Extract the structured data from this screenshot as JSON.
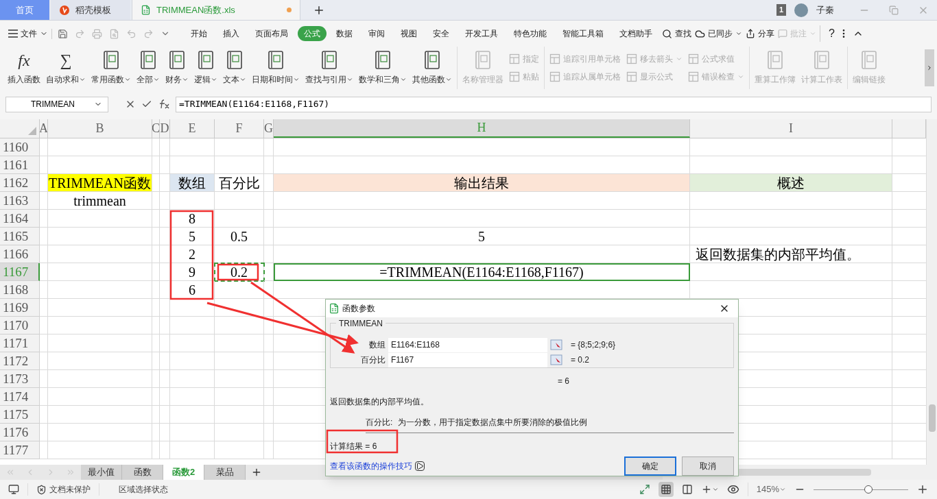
{
  "title_tabs": [
    {
      "label": "首页",
      "selected": false,
      "kind": "home"
    },
    {
      "label": "稻壳模板",
      "selected": false,
      "kind": "template"
    },
    {
      "label": "TRIMMEAN函数.xls",
      "selected": true,
      "kind": "sheet",
      "unsaved": true
    }
  ],
  "account": {
    "badge": "1",
    "name": "子秦"
  },
  "menu": {
    "file": "文件",
    "tabs": [
      {
        "label": "开始",
        "selected": false
      },
      {
        "label": "插入",
        "selected": false
      },
      {
        "label": "页面布局",
        "selected": false
      },
      {
        "label": "公式",
        "selected": true
      },
      {
        "label": "数据",
        "selected": false
      },
      {
        "label": "审阅",
        "selected": false
      },
      {
        "label": "视图",
        "selected": false
      },
      {
        "label": "安全",
        "selected": false
      },
      {
        "label": "开发工具",
        "selected": false
      },
      {
        "label": "特色功能",
        "selected": false
      },
      {
        "label": "智能工具箱",
        "selected": false
      },
      {
        "label": "文档助手",
        "selected": false
      }
    ],
    "search": "查找",
    "sync": "已同步",
    "share": "分享",
    "comment": "批注",
    "comment_disabled": true,
    "help": "?"
  },
  "ribbon": [
    [
      {
        "kind": "large",
        "label": "插入函数",
        "glyph": "fx",
        "disabled": false,
        "dropdown": false
      },
      {
        "kind": "large",
        "label": "自动求和",
        "glyph": "∑",
        "disabled": false,
        "dropdown": true
      },
      {
        "kind": "large",
        "label": "常用函数",
        "disabled": false,
        "dropdown": true
      },
      {
        "kind": "large",
        "label": "全部",
        "disabled": false,
        "dropdown": true
      },
      {
        "kind": "large",
        "label": "财务",
        "disabled": false,
        "dropdown": true
      },
      {
        "kind": "large",
        "label": "逻辑",
        "disabled": false,
        "dropdown": true
      },
      {
        "kind": "large",
        "label": "文本",
        "disabled": false,
        "dropdown": true
      },
      {
        "kind": "large",
        "label": "日期和时间",
        "disabled": false,
        "dropdown": true
      },
      {
        "kind": "large",
        "label": "查找与引用",
        "disabled": false,
        "dropdown": true
      },
      {
        "kind": "large",
        "label": "数学和三角",
        "disabled": false,
        "dropdown": true
      },
      {
        "kind": "large",
        "label": "其他函数",
        "disabled": false,
        "dropdown": true
      }
    ],
    [
      {
        "kind": "large",
        "label": "名称管理器",
        "disabled": true,
        "dropdown": false
      },
      {
        "kind": "stack",
        "items": [
          {
            "label": "指定",
            "disabled": true,
            "dropdown": false
          },
          {
            "label": "粘贴",
            "disabled": true,
            "dropdown": false
          }
        ]
      }
    ],
    [
      {
        "kind": "stack",
        "items": [
          {
            "label": "追踪引用单元格",
            "disabled": true,
            "dropdown": false
          },
          {
            "label": "追踪从属单元格",
            "disabled": true,
            "dropdown": false
          }
        ]
      },
      {
        "kind": "stack",
        "items": [
          {
            "label": "移去箭头",
            "disabled": true,
            "dropdown": true
          },
          {
            "label": "显示公式",
            "disabled": true,
            "dropdown": false
          }
        ]
      },
      {
        "kind": "stack",
        "items": [
          {
            "label": "公式求值",
            "disabled": true,
            "dropdown": false
          },
          {
            "label": "错误检查",
            "disabled": true,
            "dropdown": true
          }
        ]
      }
    ],
    [
      {
        "kind": "large",
        "label": "重算工作簿",
        "disabled": true,
        "dropdown": false
      },
      {
        "kind": "large",
        "label": "计算工作表",
        "disabled": true,
        "dropdown": false
      }
    ],
    [
      {
        "kind": "large",
        "label": "编辑链接",
        "disabled": true,
        "dropdown": false
      }
    ]
  ],
  "formula_bar": {
    "name_box": "TRIMMEAN",
    "formula": "=TRIMMEAN(E1164:E1168,F1167)"
  },
  "sheet": {
    "columns": [
      {
        "label": "A",
        "selected": false
      },
      {
        "label": "B",
        "selected": false
      },
      {
        "label": "C",
        "selected": false
      },
      {
        "label": "D",
        "selected": false
      },
      {
        "label": "E",
        "selected": false
      },
      {
        "label": "F",
        "selected": false
      },
      {
        "label": "G",
        "selected": false
      },
      {
        "label": "H",
        "selected": true
      },
      {
        "label": "I",
        "selected": false
      }
    ],
    "rows": [
      {
        "number": "1160",
        "selected": false
      },
      {
        "number": "1161",
        "selected": false
      },
      {
        "number": "1162",
        "selected": false,
        "cells": [
          {},
          {
            "text": "TRIMMEAN函数",
            "color": "#ffff00"
          },
          {},
          {},
          {
            "text": "数组",
            "color": "#dce6f1"
          },
          {
            "text": "百分比"
          },
          {},
          {
            "text": "输出结果",
            "color": "#fce4d6"
          },
          {
            "text": "概述",
            "color": "#e2efda"
          }
        ]
      },
      {
        "number": "1163",
        "selected": false,
        "cells": [
          {},
          {
            "text": "trimmean"
          }
        ]
      },
      {
        "number": "1164",
        "selected": false,
        "cells": [
          {},
          {},
          {},
          {},
          {
            "text": "8"
          }
        ]
      },
      {
        "number": "1165",
        "selected": false,
        "cells": [
          {},
          {},
          {},
          {},
          {
            "text": "5"
          },
          {
            "text": "0.5"
          },
          {},
          {
            "text": "5"
          }
        ]
      },
      {
        "number": "1166",
        "selected": false,
        "cells": [
          {},
          {},
          {},
          {},
          {
            "text": "2"
          },
          {},
          {},
          {},
          {
            "text": "返回数据集的内部平均值。",
            "kind": "note"
          }
        ]
      },
      {
        "number": "1167",
        "selected": true,
        "cells": [
          {},
          {},
          {},
          {},
          {
            "text": "9"
          },
          {
            "text": "0.2",
            "referenced": true
          },
          {},
          {
            "text": "=TRIMMEAN(E1164:E1168,F1167)",
            "active": true
          }
        ]
      },
      {
        "number": "1168",
        "selected": false,
        "cells": [
          {},
          {},
          {},
          {},
          {
            "text": "6"
          }
        ]
      },
      {
        "number": "1169",
        "selected": false
      },
      {
        "number": "1170",
        "selected": false
      },
      {
        "number": "1171",
        "selected": false
      },
      {
        "number": "1172",
        "selected": false
      },
      {
        "number": "1173",
        "selected": false
      },
      {
        "number": "1174",
        "selected": false
      },
      {
        "number": "1175",
        "selected": false
      },
      {
        "number": "1176",
        "selected": false
      },
      {
        "number": "1177",
        "selected": false
      }
    ]
  },
  "sheet_tabs": [
    {
      "label": "最小值",
      "selected": false
    },
    {
      "label": "函数",
      "selected": false
    },
    {
      "label": "函数2",
      "selected": true
    },
    {
      "label": "菜品",
      "selected": false
    }
  ],
  "status_bar": {
    "protection": "文档未保护",
    "mode": "区域选择状态",
    "zoom": "145%",
    "zoom_slider": {
      "level": 0.58
    }
  },
  "dialog": {
    "title": "函数参数",
    "function": "TRIMMEAN",
    "args": [
      {
        "label": "数组",
        "value": "E1164:E1168",
        "result": "= {8;5;2;9;6}"
      },
      {
        "label": "百分比",
        "value": "F1167",
        "result": "= 0.2"
      }
    ],
    "formula_result": "= 6",
    "description": "返回数据集的内部平均值。",
    "param_label": "百分比:",
    "param_help": "为一分数，用于指定数据点集中所要消除的极值比例",
    "computed": "计算结果 = 6",
    "help_link": "查看该函数的操作技巧",
    "buttons": [
      {
        "label": "确定",
        "default": true
      },
      {
        "label": "取消",
        "default": false
      }
    ]
  }
}
